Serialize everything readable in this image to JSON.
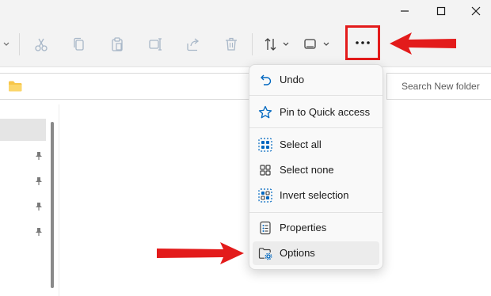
{
  "window": {
    "controls": [
      "minimize",
      "maximize",
      "close"
    ]
  },
  "toolbar": {
    "icons": [
      "cut-icon",
      "copy-icon",
      "paste-icon",
      "rename-icon",
      "share-icon",
      "delete-icon",
      "sort-icon",
      "view-icon",
      "more-options-icon"
    ]
  },
  "search": {
    "placeholder": "Search New folder"
  },
  "menu": {
    "items": [
      {
        "label": "Undo",
        "icon": "undo-icon"
      },
      {
        "label": "Pin to Quick access",
        "icon": "star-icon"
      },
      {
        "label": "Select all",
        "icon": "select-all-icon"
      },
      {
        "label": "Select none",
        "icon": "select-none-icon"
      },
      {
        "label": "Invert selection",
        "icon": "invert-selection-icon"
      },
      {
        "label": "Properties",
        "icon": "properties-icon"
      },
      {
        "label": "Options",
        "icon": "options-icon",
        "hovered": true
      }
    ]
  },
  "colors": {
    "accent": "#0067c0",
    "annotation_red": "#e31b1b",
    "toolbar_bg": "#f3f3f3"
  }
}
